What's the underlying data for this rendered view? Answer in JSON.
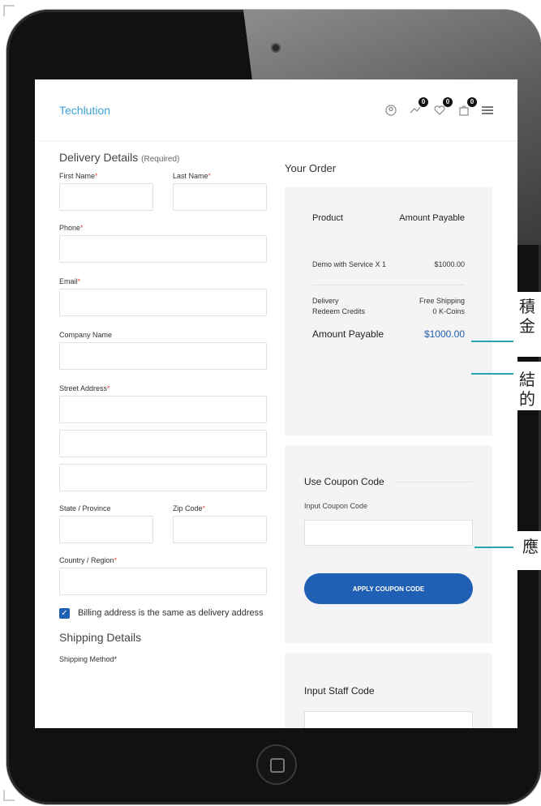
{
  "brand": {
    "logo_text": "Techlution"
  },
  "nav": {
    "icons": [
      "user-icon",
      "compare-icon",
      "wishlist-icon",
      "cart-icon",
      "menu-icon"
    ],
    "badges": {
      "compare": "0",
      "wishlist": "0",
      "cart": "0"
    }
  },
  "delivery": {
    "title": "Delivery Details",
    "required_note": "(Required)",
    "labels": {
      "first_name": "First Name",
      "last_name": "Last Name",
      "phone": "Phone",
      "email": "Email",
      "company": "Company Name",
      "street": "Street Address",
      "state": "State / Province",
      "zip": "Zip Code",
      "country": "Country / Region"
    },
    "required_mark": "*",
    "billing_same": "Billing address is the same as delivery address"
  },
  "shipping": {
    "title": "Shipping Details",
    "method_label": "Shipping Method*"
  },
  "order": {
    "title": "Your Order",
    "col_product": "Product",
    "col_amount": "Amount Payable",
    "item_name": "Demo with Service X 1",
    "item_price": "$1000.00",
    "delivery_label": "Delivery",
    "delivery_value": "Free Shipping",
    "redeem_label": "Redeem Credits",
    "redeem_value": "0 K-Coins",
    "total_label": "Amount Payable",
    "total_value": "$1000.00"
  },
  "coupon": {
    "title": "Use Coupon Code",
    "input_label": "Input Coupon Code",
    "button_label": "APPLY COUPON CODE"
  },
  "staff": {
    "title": "Input Staff Code"
  },
  "callouts": {
    "c1_line1": "積",
    "c1_line2": "金",
    "c2_line1": "結",
    "c2_line2": "的",
    "c3": "應"
  },
  "colors": {
    "accent": "#1f5fb4",
    "brand": "#3ba0d8",
    "leader": "#23a7b1",
    "required": "#e54b4b"
  }
}
